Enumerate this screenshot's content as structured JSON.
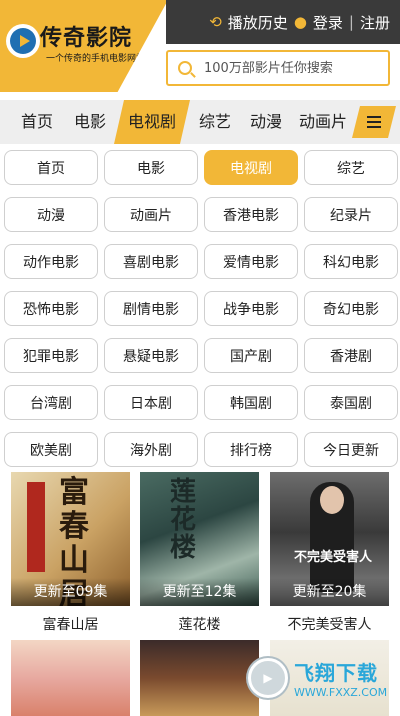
{
  "header": {
    "logo_title": "传奇影院",
    "logo_subtitle": "一个传奇的手机电影网站",
    "history": "播放历史",
    "login": "登录",
    "divider": "|",
    "register": "注册",
    "search_placeholder": "100万部影片任你搜索"
  },
  "nav": {
    "items": [
      "首页",
      "电影",
      "电视剧",
      "综艺",
      "动漫",
      "动画片"
    ],
    "active": "电视剧"
  },
  "categories": [
    "首页",
    "电影",
    "电视剧",
    "综艺",
    "动漫",
    "动画片",
    "香港电影",
    "纪录片",
    "动作电影",
    "喜剧电影",
    "爱情电影",
    "科幻电影",
    "恐怖电影",
    "剧情电影",
    "战争电影",
    "奇幻电影",
    "犯罪电影",
    "悬疑电影",
    "国产剧",
    "香港剧",
    "台湾剧",
    "日本剧",
    "韩国剧",
    "泰国剧",
    "欧美剧",
    "海外剧",
    "排行榜",
    "今日更新"
  ],
  "movies": [
    {
      "title": "富春山居",
      "status": "更新至09集",
      "poster_text": "富春山居"
    },
    {
      "title": "莲花楼",
      "status": "更新至12集",
      "poster_text": "莲花楼"
    },
    {
      "title": "不完美受害人",
      "status": "更新至20集",
      "poster_text": "不完美受害人"
    }
  ],
  "watermark": {
    "name": "飞翔下载",
    "url": "WWW.FXXZ.COM"
  },
  "colors": {
    "accent": "#f2b737",
    "topbar": "#3a3a3a",
    "navbar": "#eeeeee"
  }
}
